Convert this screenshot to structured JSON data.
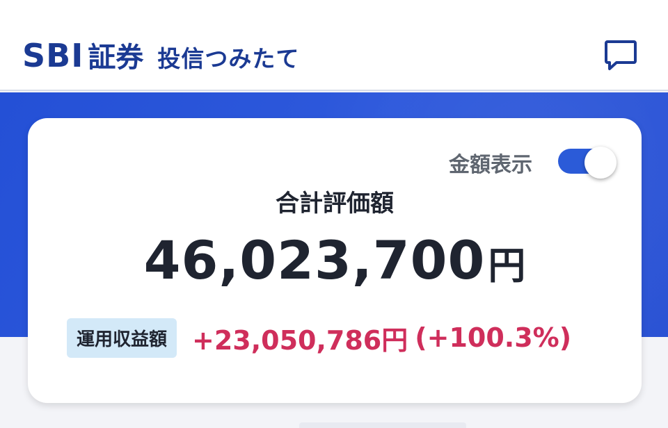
{
  "header": {
    "logo_main": "SBI",
    "logo_secondary": "証券",
    "logo_sub": "投信つみたて",
    "chat_icon": "chat-bubble-icon"
  },
  "card": {
    "toggle_label": "金額表示",
    "toggle_on": true,
    "total_label": "合計評価額",
    "total_amount": "46,023,700",
    "total_unit": "円",
    "profit_badge": "運用収益額",
    "profit_value": "+23,050,786円",
    "profit_percent": "(+100.3%)"
  },
  "colors": {
    "brand_navy": "#1b3a93",
    "hero_blue": "#2b55d9",
    "toggle_blue": "#2b5bd8",
    "profit_red": "#cf2e5b",
    "badge_bg": "#d3e9f8"
  }
}
